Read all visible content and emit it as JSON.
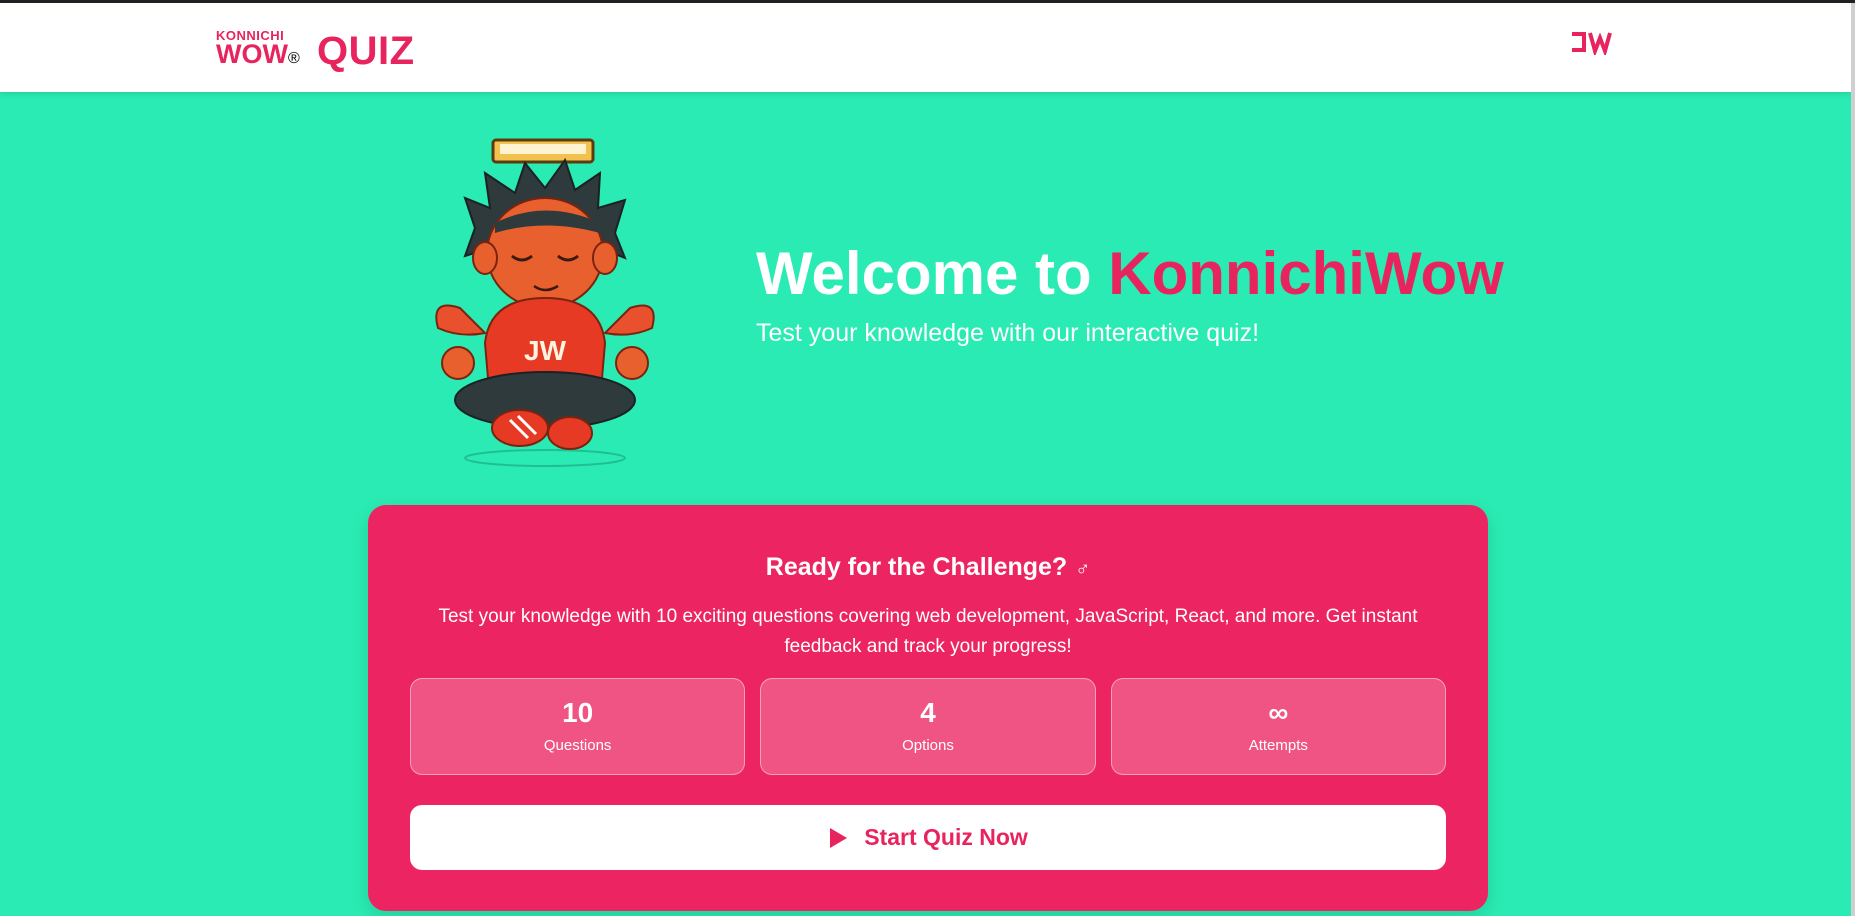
{
  "header": {
    "brand_small": "KONNICHI",
    "brand_big": "WOW",
    "brand_reg": "®",
    "title": "QUIZ",
    "logo_icon": "jw-logo-icon"
  },
  "hero": {
    "welcome_prefix": "Welcome to ",
    "welcome_brand": "KonnichiWow",
    "tagline": "Test your knowledge with our interactive quiz!",
    "mascot": "mascot-image",
    "mascot_hoodie_text": "JW"
  },
  "card": {
    "title": "Ready for the Challenge?",
    "title_emoji": "♂",
    "description": "Test your knowledge with 10 exciting questions covering web development, JavaScript, React, and more. Get instant feedback and track your progress!",
    "stats": [
      {
        "value": "10",
        "label": "Questions"
      },
      {
        "value": "4",
        "label": "Options"
      },
      {
        "value": "∞",
        "label": "Attempts"
      }
    ],
    "start_label": "Start Quiz Now",
    "start_icon": "play-icon"
  },
  "colors": {
    "background": "#2aebb3",
    "accent": "#e8245f",
    "card": "#ec2462",
    "header": "#ffffff"
  }
}
